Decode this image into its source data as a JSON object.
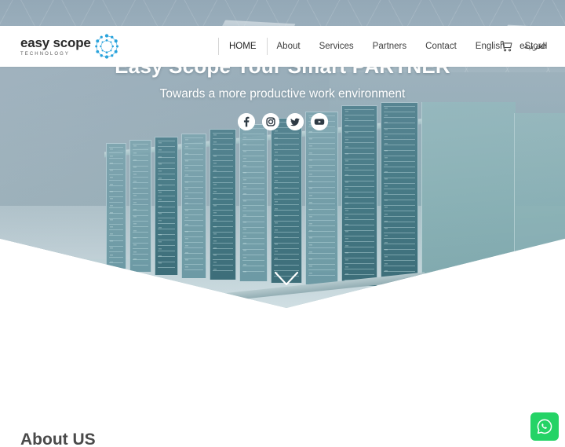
{
  "brand": {
    "name": "easy scope",
    "tagline": "TECHNOLOGY",
    "mark_icon": "dotted-circle-logo-icon",
    "accent_color": "#29a3dc"
  },
  "nav": {
    "items": [
      {
        "label": "HOME",
        "active": true
      },
      {
        "label": "About",
        "active": false
      },
      {
        "label": "Services",
        "active": false
      },
      {
        "label": "Partners",
        "active": false
      },
      {
        "label": "Contact",
        "active": false
      },
      {
        "label": "English",
        "active": false
      },
      {
        "label": "العربية",
        "active": false
      }
    ],
    "estore": {
      "label": "eStore",
      "icon": "shopping-cart-icon"
    }
  },
  "hero": {
    "title": "Easy Scope Your Smart PARTNER",
    "subtitle": "Towards a more productive work environment",
    "scroll_icon": "chevron-down-icon",
    "background_image": "data-center-server-racks",
    "socials": [
      {
        "name": "facebook",
        "icon": "facebook-icon"
      },
      {
        "name": "instagram",
        "icon": "instagram-icon"
      },
      {
        "name": "twitter",
        "icon": "twitter-icon"
      },
      {
        "name": "youtube",
        "icon": "youtube-icon"
      }
    ]
  },
  "about": {
    "title": "About US"
  },
  "floating": {
    "whatsapp": {
      "label": "WhatsApp",
      "icon": "whatsapp-icon",
      "color": "#25d366"
    }
  }
}
